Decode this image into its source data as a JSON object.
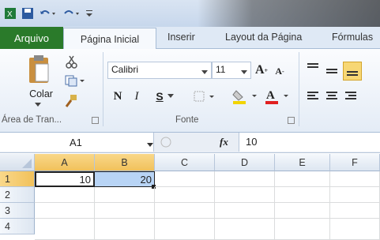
{
  "tabs": [
    "Arquivo",
    "Página Inicial",
    "Inserir",
    "Layout da Página",
    "Fórmulas"
  ],
  "clipboard": {
    "paste_label": "Colar",
    "group_label": "Área de Tran..."
  },
  "font": {
    "name": "Calibri",
    "size": "11",
    "bold": "N",
    "italic": "I",
    "underline": "S",
    "group_label": "Fonte"
  },
  "formula_bar": {
    "name_box": "A1",
    "fx": "fx",
    "value": "10"
  },
  "columns": [
    "A",
    "B",
    "C",
    "D",
    "E",
    "F"
  ],
  "rows": [
    "1",
    "2",
    "3",
    "4"
  ],
  "cells": {
    "a1": "10",
    "b1": "20"
  },
  "colors": {
    "file_tab": "#2a7a2a",
    "selection": "#b8d4f5",
    "align_active": "#f7d774"
  }
}
